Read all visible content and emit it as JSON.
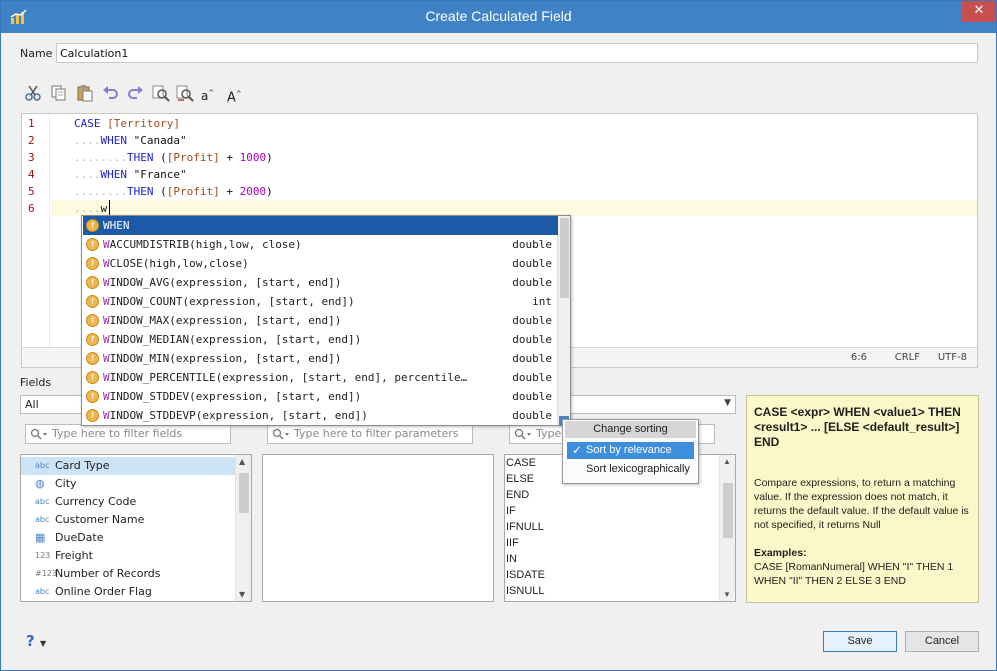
{
  "window": {
    "title": "Create Calculated Field",
    "close_glyph": "✕"
  },
  "name": {
    "label": "Name",
    "value": "Calculation1"
  },
  "toolbar": {
    "icons": [
      "cut-icon",
      "copy-icon",
      "paste-icon",
      "undo-icon",
      "redo-icon",
      "find-icon",
      "replace-icon",
      "lowercase-icon",
      "uppercase-icon"
    ],
    "lower_label": "a",
    "upper_label": "A"
  },
  "editor": {
    "line_numbers": [
      "1",
      "2",
      "3",
      "4",
      "5",
      "6"
    ],
    "lines": [
      {
        "dots": "",
        "tokens": [
          {
            "t": "CASE",
            "c": "kw"
          },
          {
            "t": " ",
            "c": ""
          },
          {
            "t": "[Territory]",
            "c": "fld"
          }
        ]
      },
      {
        "dots": "....",
        "tokens": [
          {
            "t": "WHEN",
            "c": "kw"
          },
          {
            "t": " \"Canada\"",
            "c": "str"
          }
        ]
      },
      {
        "dots": "........",
        "tokens": [
          {
            "t": "THEN",
            "c": "kw"
          },
          {
            "t": " (",
            "c": "str"
          },
          {
            "t": "[Profit]",
            "c": "fld"
          },
          {
            "t": " + ",
            "c": "str"
          },
          {
            "t": "1000",
            "c": "num"
          },
          {
            "t": ")",
            "c": "str"
          }
        ]
      },
      {
        "dots": "....",
        "tokens": [
          {
            "t": "WHEN",
            "c": "kw"
          },
          {
            "t": " \"France\"",
            "c": "str"
          }
        ]
      },
      {
        "dots": "........",
        "tokens": [
          {
            "t": "THEN",
            "c": "kw"
          },
          {
            "t": " (",
            "c": "str"
          },
          {
            "t": "[Profit]",
            "c": "fld"
          },
          {
            "t": " + ",
            "c": "str"
          },
          {
            "t": "2000",
            "c": "num"
          },
          {
            "t": ")",
            "c": "str"
          }
        ]
      },
      {
        "dots": "....",
        "tokens": [
          {
            "t": "w",
            "c": "str"
          }
        ]
      }
    ],
    "status": {
      "position": "6:6",
      "eol": "CRLF",
      "encoding": "UTF-8"
    }
  },
  "autocomplete": {
    "items": [
      {
        "prefix": "W",
        "rest": "HEN",
        "type": "",
        "selected": true
      },
      {
        "prefix": "W",
        "rest": "ACCUMDISTRIB(high,low, close)",
        "type": "double"
      },
      {
        "prefix": "W",
        "rest": "CLOSE(high,low,close)",
        "type": "double"
      },
      {
        "prefix": "W",
        "rest": "INDOW_AVG(expression, [start, end])",
        "type": "double"
      },
      {
        "prefix": "W",
        "rest": "INDOW_COUNT(expression, [start, end])",
        "type": "int"
      },
      {
        "prefix": "W",
        "rest": "INDOW_MAX(expression, [start, end])",
        "type": "double"
      },
      {
        "prefix": "W",
        "rest": "INDOW_MEDIAN(expression, [start, end])",
        "type": "double"
      },
      {
        "prefix": "W",
        "rest": "INDOW_MIN(expression, [start, end])",
        "type": "double"
      },
      {
        "prefix": "W",
        "rest": "INDOW_PERCENTILE(expression, [start, end], percentile…",
        "type": "double"
      },
      {
        "prefix": "W",
        "rest": "INDOW_STDDEV(expression, [start, end])",
        "type": "double"
      },
      {
        "prefix": "W",
        "rest": "INDOW_STDDEVP(expression, [start, end])",
        "type": "double"
      }
    ],
    "icon_letter": "f"
  },
  "fields": {
    "label": "Fields",
    "combo_value": "All",
    "filter_placeholder": "Type here to filter fields",
    "params_placeholder": "Type here to filter parameters",
    "functions_placeholder": "Type",
    "items": [
      {
        "icon": "abc",
        "label": "Card Type",
        "selected": true
      },
      {
        "icon": "globe",
        "label": "City"
      },
      {
        "icon": "abc",
        "label": "Currency Code"
      },
      {
        "icon": "abc",
        "label": "Customer Name"
      },
      {
        "icon": "date",
        "label": "DueDate"
      },
      {
        "icon": "123",
        "label": "Freight"
      },
      {
        "icon": "#123",
        "label": "Number of Records"
      },
      {
        "icon": "abc",
        "label": "Online Order Flag"
      }
    ]
  },
  "functions": {
    "items": [
      "CASE",
      "ELSE",
      "END",
      "IF",
      "IFNULL",
      "IIF",
      "IN",
      "ISDATE",
      "ISNULL"
    ]
  },
  "sort_menu": {
    "title": "Change sorting",
    "options": [
      {
        "label": "Sort by relevance",
        "active": true
      },
      {
        "label": "Sort lexicographically",
        "active": false
      }
    ]
  },
  "help": {
    "signature": "CASE <expr> WHEN <value1> THEN <result1> ... [ELSE <default_result>] END",
    "description": "Compare expressions, to return a matching value. If the expression does not match, it returns the default value. If the default value is not specified, it returns Null",
    "examples_heading": "Examples:",
    "example": "CASE [RomanNumeral] WHEN \"I\" THEN 1 WHEN \"II\" THEN 2 ELSE 3 END"
  },
  "buttons": {
    "save": "Save",
    "cancel": "Cancel",
    "help_glyph": "?"
  },
  "colors": {
    "titlebar": "#3f83c6",
    "keyword": "#1b1fd0",
    "field": "#a04a1a",
    "number": "#b000c0",
    "selection": "#1c59a6"
  }
}
